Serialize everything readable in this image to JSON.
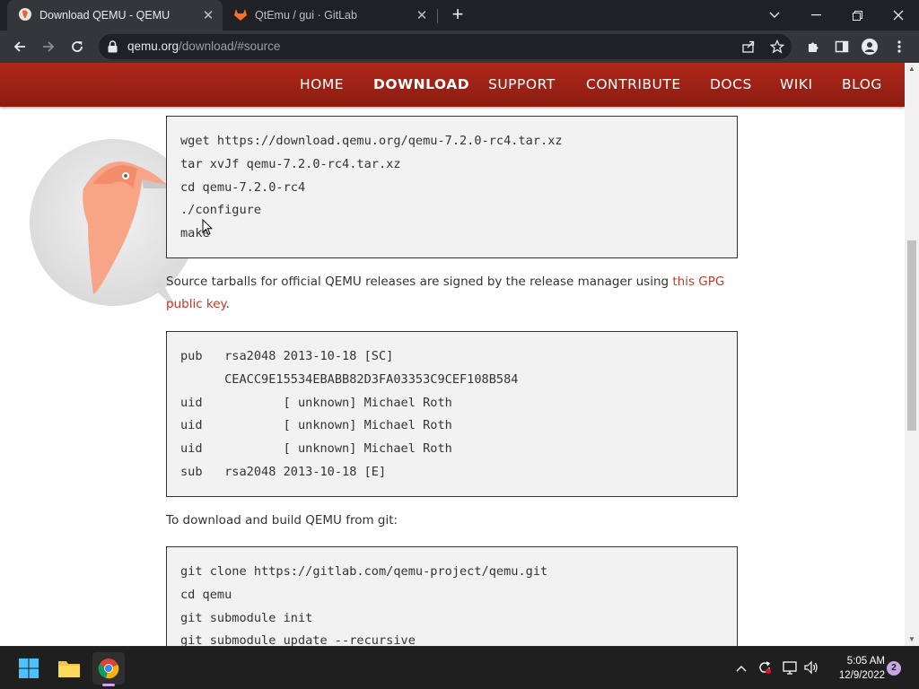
{
  "browser": {
    "tabs": [
      {
        "title": "Download QEMU - QEMU",
        "active": true,
        "icon": "qemu-favicon"
      },
      {
        "title": "QtEmu / gui · GitLab",
        "active": false,
        "icon": "gitlab-favicon"
      }
    ],
    "url_host": "qemu.org",
    "url_path": "/download/#source"
  },
  "site_nav": {
    "items": [
      "HOME",
      "DOWNLOAD",
      "SUPPORT",
      "CONTRIBUTE",
      "DOCS",
      "WIKI",
      "BLOG"
    ],
    "current": "DOWNLOAD"
  },
  "code_build": [
    "wget https://download.qemu.org/qemu-7.2.0-rc4.tar.xz",
    "tar xvJf qemu-7.2.0-rc4.tar.xz",
    "cd qemu-7.2.0-rc4",
    "./configure",
    "make"
  ],
  "gpg_para": {
    "text": "Source tarballs for official QEMU releases are signed by the release manager using ",
    "link": "this GPG public key",
    "end": "."
  },
  "code_gpg": [
    "pub   rsa2048 2013-10-18 [SC]",
    "      CEACC9E15534EBABB82D3FA03353C9CEF108B584",
    "uid           [ unknown] Michael Roth",
    "uid           [ unknown] Michael Roth",
    "uid           [ unknown] Michael Roth",
    "sub   rsa2048 2013-10-18 [E]"
  ],
  "git_para": "To download and build QEMU from git:",
  "code_git": [
    "git clone https://gitlab.com/qemu-project/qemu.git",
    "cd qemu",
    "git submodule init",
    "git submodule update --recursive"
  ],
  "taskbar": {
    "time": "5:05 AM",
    "date": "12/9/2022",
    "notifications": "2"
  },
  "colors": {
    "nav_red": "#a1241a",
    "link_red": "#c0392b",
    "code_bg": "#f2f2f2"
  }
}
